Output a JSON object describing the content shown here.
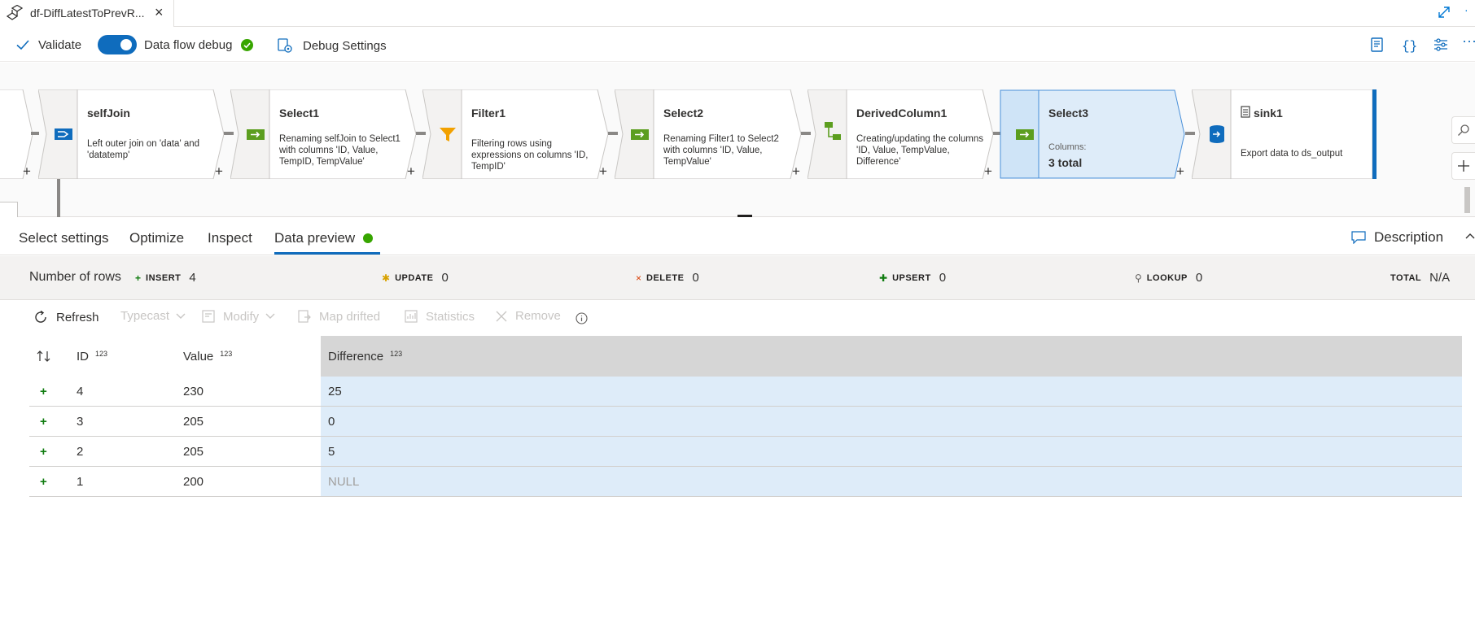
{
  "tab": {
    "title": "df-DiffLatestToPrevR..."
  },
  "toolbar": {
    "validate_label": "Validate",
    "debug_label": "Data flow debug",
    "debug_on": true,
    "debug_settings_label": "Debug Settings"
  },
  "nodes": [
    {
      "title": "selfJoin",
      "desc": "Left outer join on 'data' and 'datatemp'",
      "icon": "join-icon"
    },
    {
      "title": "Select1",
      "desc": "Renaming selfJoin to Select1 with columns 'ID, Value, TempID, TempValue'",
      "icon": "select-icon"
    },
    {
      "title": "Filter1",
      "desc": "Filtering rows using expressions on columns 'ID, TempID'",
      "icon": "filter-icon"
    },
    {
      "title": "Select2",
      "desc": "Renaming Filter1 to Select2 with columns 'ID, Value, TempValue'",
      "icon": "select-icon"
    },
    {
      "title": "DerivedColumn1",
      "desc": "Creating/updating the columns 'ID, Value, TempValue, Difference'",
      "icon": "derived-column-icon"
    },
    {
      "title": "Select3",
      "sub_label": "Columns:",
      "sub_value": "3 total",
      "icon": "select-icon",
      "selected": true
    },
    {
      "title": "sink1",
      "desc": "Export data to ds_output",
      "icon": "sink-icon"
    }
  ],
  "panel_tabs": [
    {
      "label": "Select settings"
    },
    {
      "label": "Optimize"
    },
    {
      "label": "Inspect"
    },
    {
      "label": "Data preview",
      "active": true
    }
  ],
  "description_label": "Description",
  "counts": {
    "title": "Number of rows",
    "insert_label": "INSERT",
    "insert_value": "4",
    "update_label": "UPDATE",
    "update_value": "0",
    "delete_label": "DELETE",
    "delete_value": "0",
    "upsert_label": "UPSERT",
    "upsert_value": "0",
    "lookup_label": "LOOKUP",
    "lookup_value": "0",
    "total_label": "TOTAL",
    "total_value": "N/A"
  },
  "preview_toolbar": {
    "refresh": "Refresh",
    "typecast": "Typecast",
    "modify": "Modify",
    "map_drifted": "Map drifted",
    "statistics": "Statistics",
    "remove": "Remove"
  },
  "grid": {
    "columns": [
      {
        "name": "ID",
        "type": "123"
      },
      {
        "name": "Value",
        "type": "123"
      },
      {
        "name": "Difference",
        "type": "123"
      }
    ],
    "rows": [
      {
        "id": "4",
        "value": "230",
        "difference": "25"
      },
      {
        "id": "3",
        "value": "205",
        "difference": "0"
      },
      {
        "id": "2",
        "value": "205",
        "difference": "5"
      },
      {
        "id": "1",
        "value": "200",
        "difference": "NULL"
      }
    ]
  },
  "colors": {
    "accent": "#0f6cbd",
    "selected_node": "#deecf9",
    "insert_green": "#107c10"
  }
}
